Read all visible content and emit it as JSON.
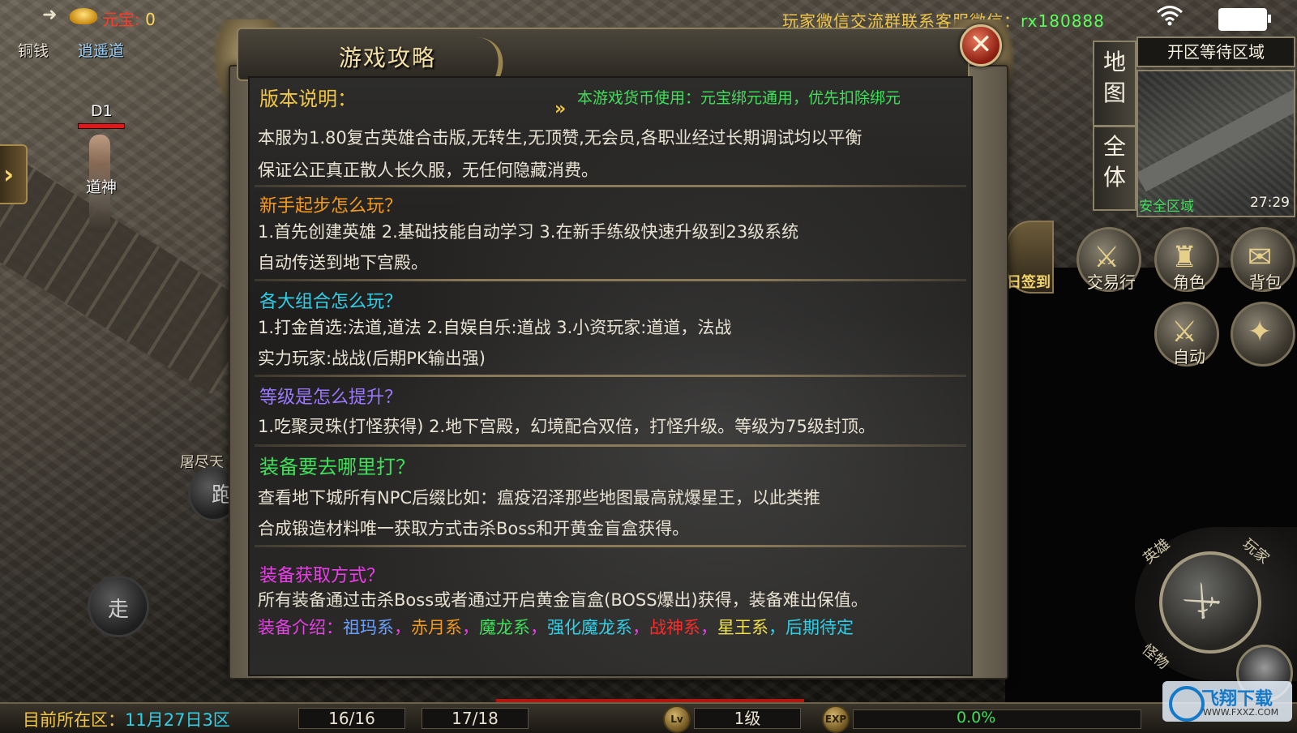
{
  "top_hud": {
    "yuanbao_label": "元宝:",
    "yuanbao_value": "0",
    "contact_prefix": "玩家微信交流群联系客服微信：",
    "contact_wechat": "rx180888"
  },
  "left_area": {
    "labels": [
      "铜钱",
      "逍遥道",
      "D1",
      "道神",
      "屠尽天"
    ],
    "walk_label": "走",
    "run_label": "跑",
    "side_arrow": "›"
  },
  "dialog": {
    "title": "游戏攻略",
    "close_icon": "close-icon",
    "version_title": "版本说明：",
    "notice": "本游戏货币使用：元宝绑元通用，优先扣除绑元",
    "version_lines": [
      "本服为1.80复古英雄合击版,无转生,无顶赞,无会员,各职业经过长期调试均以平衡",
      "保证公正真正散人长久服，无任何隐藏消费。"
    ],
    "newbie_title": "新手起步怎么玩？",
    "newbie_lines": [
      "1.首先创建英雄  2.基础技能自动学习    3.在新手练级快速升级到23级系统",
      "自动传送到地下宫殿。"
    ],
    "combo_title": "各大组合怎么玩？",
    "combo_lines": [
      "1.打金首选:法道,道法   2.自娱自乐:道战    3.小资玩家:道道，法战",
      "实力玩家:战战(后期PK输出强)"
    ],
    "level_title": "等级是怎么提升？",
    "level_lines": [
      "1.吃聚灵珠(打怪获得)   2.地下宫殿，幻境配合双倍，打怪升级。等级为75级封顶。"
    ],
    "equip_where_title": "装备要去哪里打？",
    "equip_where_lines": [
      "查看地下城所有NPC后缀比如：瘟疫沼泽那些地图最高就爆星王，以此类推",
      "合成锻造材料唯一获取方式击杀Boss和开黄金盲盒获得。"
    ],
    "equip_get_title": "装备获取方式？",
    "equip_get_lines": [
      "所有装备通过击杀Boss或者通过开启黄金盲盒(BOSS爆出)获得，装备难出保值。"
    ],
    "equip_intro": [
      {
        "text": "装备介绍：",
        "color": "#e83fe8"
      },
      {
        "text": "祖玛系",
        "color": "#6aa0ff"
      },
      {
        "text": "，",
        "color": "#e83fe8"
      },
      {
        "text": "赤月系",
        "color": "#f39a1c"
      },
      {
        "text": "，",
        "color": "#e83fe8"
      },
      {
        "text": "魔龙系",
        "color": "#3ee05a"
      },
      {
        "text": "，",
        "color": "#e83fe8"
      },
      {
        "text": "强化魔龙系",
        "color": "#2fd0e8"
      },
      {
        "text": "，",
        "color": "#e83fe8"
      },
      {
        "text": "战神系",
        "color": "#ff2a2a"
      },
      {
        "text": "，",
        "color": "#e83fe8"
      },
      {
        "text": "星王系",
        "color": "#f0e04a"
      },
      {
        "text": "，后期待定",
        "color": "#2fd0e8"
      }
    ]
  },
  "right_hud": {
    "map_label_1": "地图",
    "map_label_2": "全体",
    "zone_title": "开区等待区域",
    "safe_zone": "安全区域",
    "timer": "27:29",
    "buttons": {
      "signin": "日签到",
      "trade": "交易行",
      "role": "角色",
      "bag": "背包",
      "auto": "自动"
    },
    "joystick_labels": [
      "英雄",
      "玩家",
      "怪物"
    ]
  },
  "bottom_bar": {
    "zone_label": "目前所在区：",
    "zone_value": "11月27日3区",
    "slot1": "16/16",
    "slot2": "17/18",
    "lv_icon": "Lv",
    "level": "1级",
    "exp_icon": "EXP",
    "exp_percent": "0.0%",
    "exp_fraction": 0.0
  },
  "watermark": {
    "brand": "飞翔下载",
    "url": "WWW.FXXZ.COM"
  }
}
